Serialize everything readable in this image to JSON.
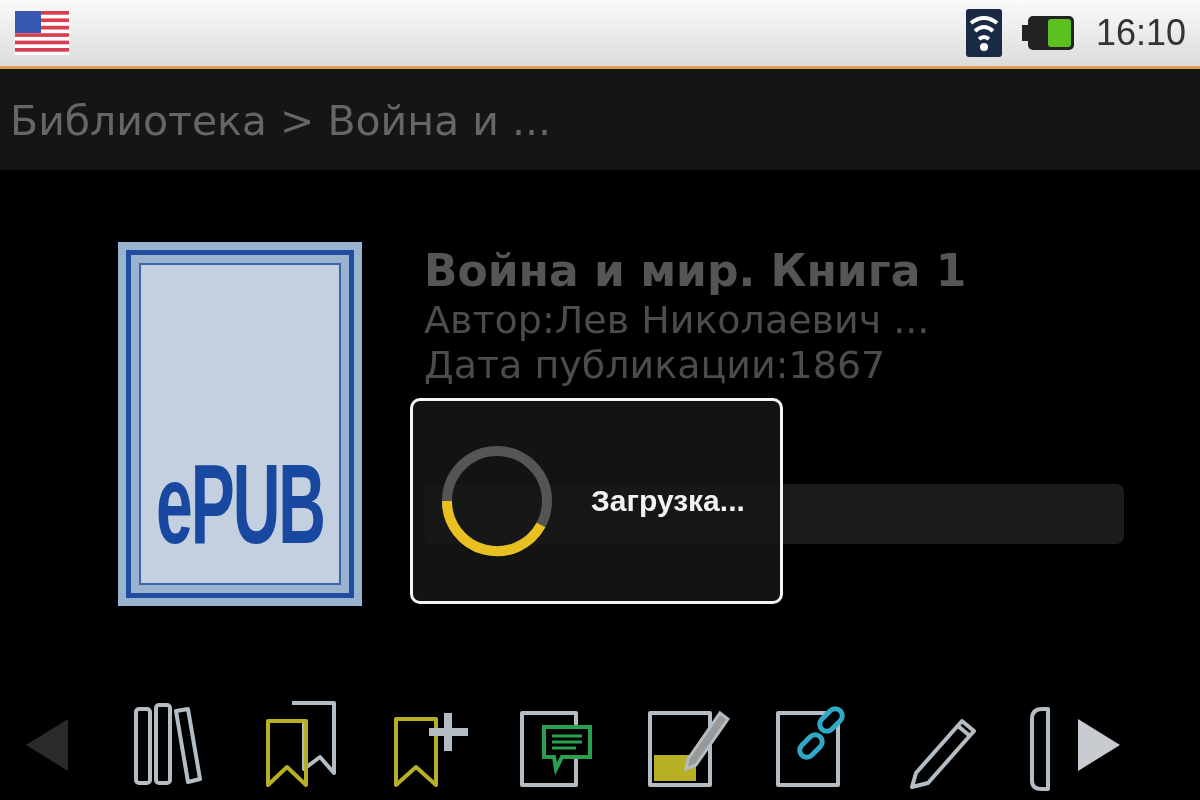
{
  "status_bar": {
    "time": "16:10"
  },
  "breadcrumb": "Библиотека > Война и ...",
  "book": {
    "cover_label": "ePUB",
    "title": "Война и мир. Книга 1",
    "author": "Автор:Лев Николаевич ...",
    "date": "Дата публикации:1867"
  },
  "dialog": {
    "message": "Загрузка..."
  },
  "toolbar": {
    "prev": {
      "disabled": true
    },
    "next": {
      "disabled": false
    },
    "items": [
      {
        "kind": "library"
      },
      {
        "kind": "bookmarks"
      },
      {
        "kind": "add-bookmark"
      },
      {
        "kind": "note"
      },
      {
        "kind": "highlight"
      },
      {
        "kind": "link"
      },
      {
        "kind": "pencil"
      },
      {
        "kind": "page"
      }
    ]
  }
}
